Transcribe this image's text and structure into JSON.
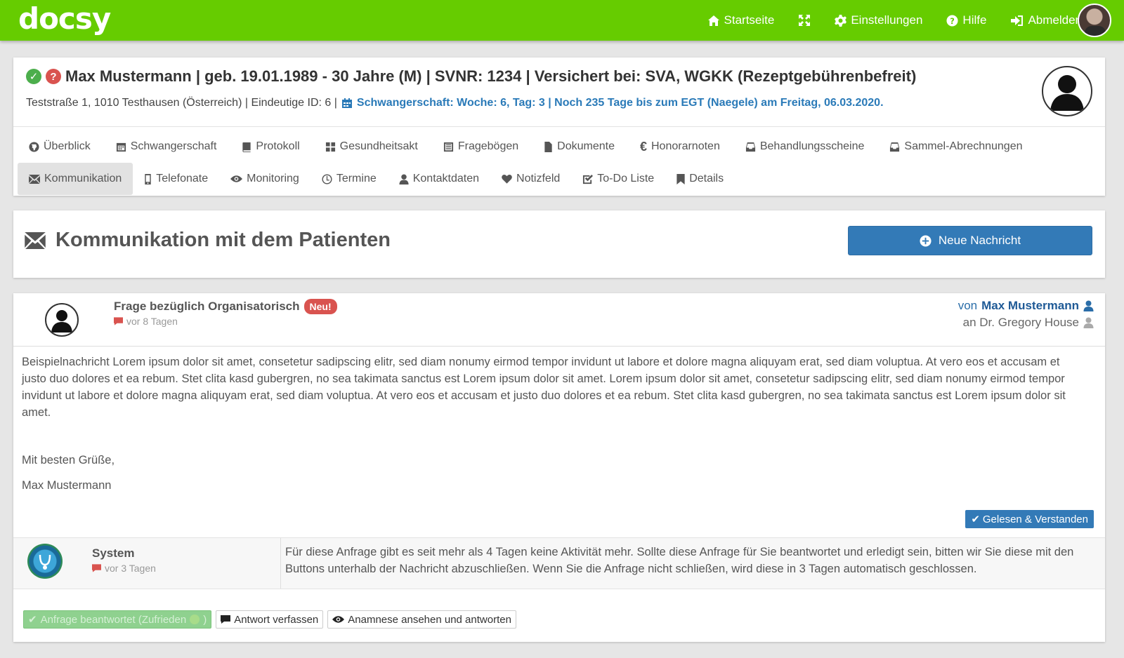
{
  "app": {
    "logo": "docsy"
  },
  "topnav": {
    "home": "Startseite",
    "settings": "Einstellungen",
    "help": "Hilfe",
    "logout": "Abmelden"
  },
  "patient": {
    "title": "Max Mustermann | geb. 19.01.1989 - 30 Jahre (M) | SVNR: 1234 | Versichert bei: SVA, WGKK (Rezeptgebührenbefreit)",
    "address": "Teststraße 1, 1010 Testhausen (Österreich) | Eindeutige ID: 6 |",
    "pregnancy": "Schwangerschaft: Woche: 6, Tag: 3 | Noch 235 Tage bis zum EGT (Naegele) am Freitag, 06.03.2020."
  },
  "tabs_row1": [
    {
      "label": "Überblick"
    },
    {
      "label": "Schwangerschaft"
    },
    {
      "label": "Protokoll"
    },
    {
      "label": "Gesundheitsakt"
    },
    {
      "label": "Fragebögen"
    },
    {
      "label": "Dokumente"
    },
    {
      "label": "Honorarnoten"
    },
    {
      "label": "Behandlungsscheine"
    },
    {
      "label": "Sammel-Abrechnungen"
    }
  ],
  "tabs_row2": [
    {
      "label": "Kommunikation"
    },
    {
      "label": "Telefonate"
    },
    {
      "label": "Monitoring"
    },
    {
      "label": "Termine"
    },
    {
      "label": "Kontaktdaten"
    },
    {
      "label": "Notizfeld"
    },
    {
      "label": "To-Do Liste"
    },
    {
      "label": "Details"
    }
  ],
  "section": {
    "title": "Kommunikation mit dem Patienten",
    "new_button": "Neue Nachricht"
  },
  "message": {
    "subject": "Frage bezüglich Organisatorisch",
    "badge": "Neu!",
    "time": "vor 8 Tagen",
    "from_prefix": "von",
    "from_name": "Max Mustermann",
    "to": "an Dr. Gregory House",
    "body": "Beispielnachricht Lorem ipsum dolor sit amet, consetetur sadipscing elitr, sed diam nonumy eirmod tempor invidunt ut labore et dolore magna aliquyam erat, sed diam voluptua. At vero eos et accusam et justo duo dolores et ea rebum. Stet clita kasd gubergren, no sea takimata sanctus est Lorem ipsum dolor sit amet. Lorem ipsum dolor sit amet, consetetur sadipscing elitr, sed diam nonumy eirmod tempor invidunt ut labore et dolore magna aliquyam erat, sed diam voluptua. At vero eos et accusam et justo duo dolores et ea rebum. Stet clita kasd gubergren, no sea takimata sanctus est Lorem ipsum dolor sit amet.",
    "greeting": "Mit besten Grüße,",
    "signature": "Max Mustermann",
    "read_button": "Gelesen & Verstanden"
  },
  "system": {
    "name": "System",
    "time": "vor 3 Tagen",
    "text": "Für diese Anfrage gibt es seit mehr als 4 Tagen keine Aktivität mehr. Sollte diese Anfrage für Sie beantwortet und erledigt sein, bitten wir Sie diese mit den Buttons unterhalb der Nachricht abzuschließen. Wenn Sie die Anfrage nicht schließen, wird diese in 3 Tagen automatisch geschlossen."
  },
  "actions": {
    "answered": "Anfrage beantwortet (Zufrieden",
    "answered_end": ")",
    "reply": "Antwort verfassen",
    "anamnesis": "Anamnese ansehen und antworten"
  },
  "colors": {
    "topbar": "#66cc00",
    "primary": "#337ab7",
    "danger": "#d9534f",
    "success": "#4cae4c"
  }
}
